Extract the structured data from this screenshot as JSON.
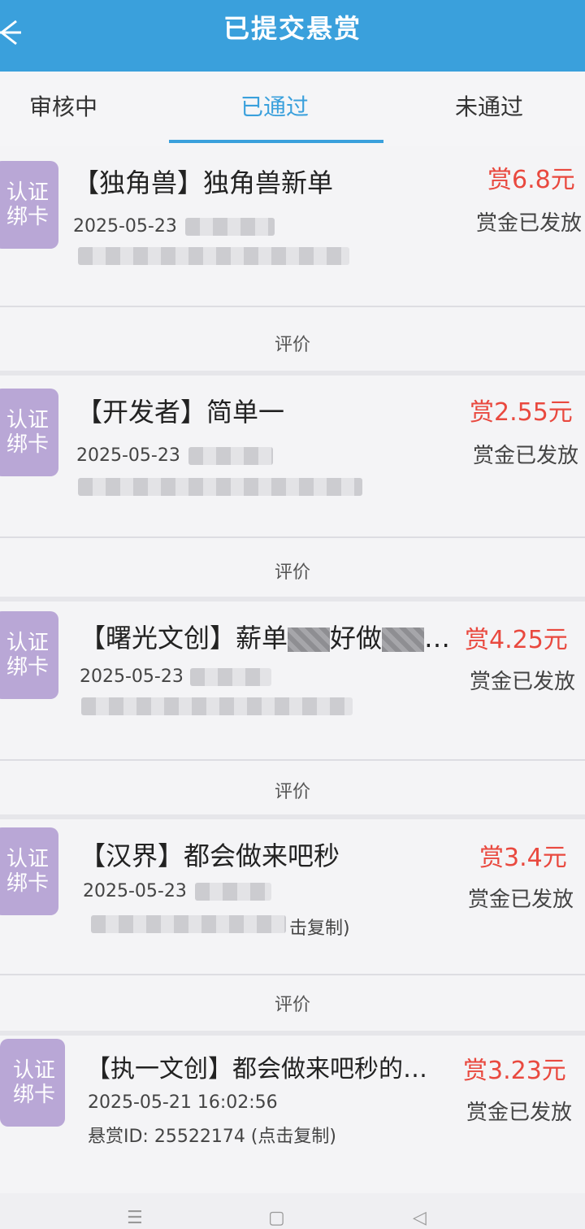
{
  "header": {
    "title": "已提交悬赏"
  },
  "tabs": [
    {
      "label": "审核中"
    },
    {
      "label": "已通过"
    },
    {
      "label": "未通过"
    }
  ],
  "badge": {
    "line1": "认证",
    "line2": "绑卡"
  },
  "review_label": "评价",
  "items": [
    {
      "title": "【独角兽】独角兽新单",
      "reward": "赏6.8元",
      "status": "赏金已发放",
      "date": "2025-05-23"
    },
    {
      "title": "【开发者】简单一",
      "reward": "赏2.55元",
      "status": "赏金已发放",
      "date": "2025-05-23"
    },
    {
      "title_part1": "【曙光文创】薪单",
      "title_part2": "好做",
      "title_part3": "…",
      "reward": "赏4.25元",
      "status": "赏金已发放",
      "date": "2025-05-23"
    },
    {
      "title": "【汉界】都会做来吧秒",
      "reward": "赏3.4元",
      "status": "赏金已发放",
      "date": "2025-05-23",
      "idline_tail": "击复制)"
    },
    {
      "title": "【执一文创】都会做来吧秒的…",
      "reward": "赏3.23元",
      "status": "赏金已发放",
      "date": "2025-05-21 16:02:56",
      "idline": "悬赏ID: 25522174 (点击复制)"
    }
  ],
  "colors": {
    "header": "#3aa0dc",
    "accent": "#3aa0dc",
    "reward": "#e9493f",
    "badge": "#b9a7d6"
  }
}
